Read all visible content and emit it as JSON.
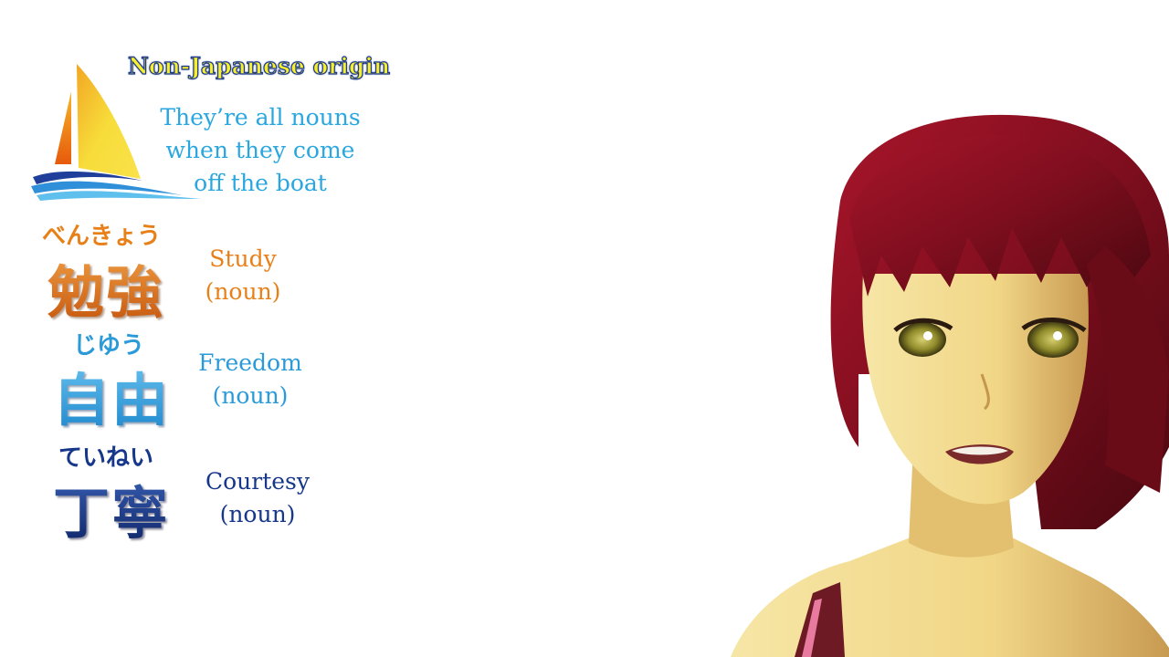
{
  "header": {
    "title": "Non-Japanese origin",
    "subtitle_lines": [
      "They’re all nouns",
      "when they come",
      "off the boat"
    ]
  },
  "vocab": [
    {
      "furigana": "べんきょう",
      "kanji": "勉強",
      "meaning": "Study",
      "pos": "(noun)",
      "color": "#e8801a"
    },
    {
      "furigana": "じゆう",
      "kanji": "自由",
      "meaning": "Freedom",
      "pos": "(noun)",
      "color": "#2a9ad8"
    },
    {
      "furigana": "ていねい",
      "kanji": "丁寧",
      "meaning": "Courtesy",
      "pos": "(noun)",
      "color": "#16378a"
    }
  ],
  "icons": {
    "logo": "sailboat-icon",
    "character": "anime-girl-illustration"
  },
  "colors": {
    "title_fill": "#f7ef2a",
    "title_outline": "#1e3a8c",
    "subtitle": "#2aa7e0",
    "hair": "#8a1020",
    "skin": "#f2d98a"
  }
}
